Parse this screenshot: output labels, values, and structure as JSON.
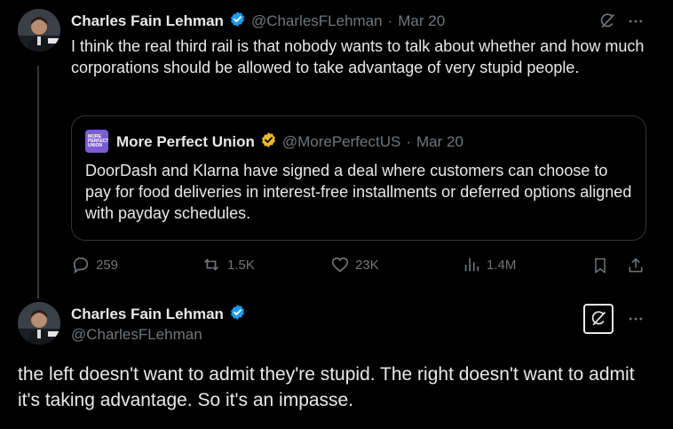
{
  "tweet1": {
    "author_name": "Charles Fain Lehman",
    "handle": "@CharlesFLehman",
    "separator": "·",
    "date": "Mar 20",
    "text": "I think the real third rail is that nobody wants to talk about whether and how much corporations should be allowed to take advantage of very stupid people.",
    "quote": {
      "logo_text": "MORE PERFECT UNION",
      "author_name": "More Perfect Union",
      "handle": "@MorePerfectUS",
      "separator": "·",
      "date": "Mar 20",
      "text": "DoorDash and Klarna have signed a deal where customers can choose to pay for food deliveries in  interest-free installments or deferred options aligned with payday schedules."
    },
    "actions": {
      "replies": "259",
      "reposts": "1.5K",
      "likes": "23K",
      "views": "1.4M"
    }
  },
  "tweet2": {
    "author_name": "Charles Fain Lehman",
    "handle": "@CharlesFLehman",
    "text": "the left doesn't want to admit they're stupid. The right doesn't want to admit it's taking advantage. So it's an impasse."
  },
  "colors": {
    "background": "#000000",
    "text": "#e7e9ea",
    "muted": "#71767b",
    "verified_blue": "#1d9bf0",
    "verified_gold": "#e8b82b",
    "border": "#2f3336"
  }
}
